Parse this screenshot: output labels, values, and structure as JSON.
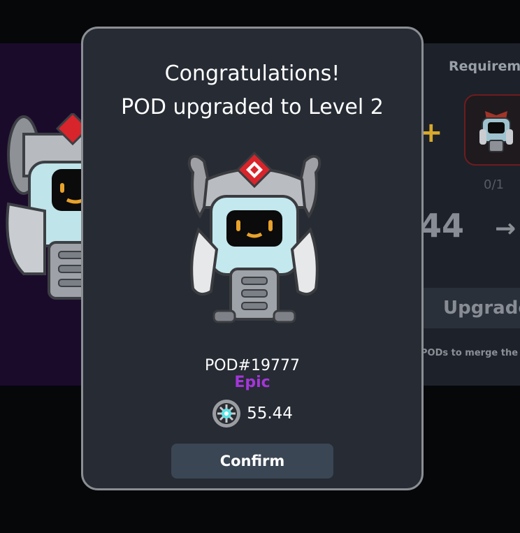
{
  "modal": {
    "title_line1": "Congratulations!",
    "title_line2": "POD upgraded to Level 2",
    "pod_name": "POD#19777",
    "rarity": "Epic",
    "value": "55.44",
    "confirm_label": "Confirm",
    "rarity_color": "#a436d8",
    "coin_icon": "token-coin-icon"
  },
  "background_panel": {
    "requirements_label": "Requirem",
    "requirement_count": "0/1",
    "current_value_partial": "44",
    "upgrade_label": "Upgrade",
    "merge_note": "PODs to merge the"
  },
  "colors": {
    "modal_bg": "#262b34",
    "confirm_bg": "#3b4654",
    "left_panel_bg": "#1b0b2b",
    "plus_color": "#d9a92c"
  }
}
